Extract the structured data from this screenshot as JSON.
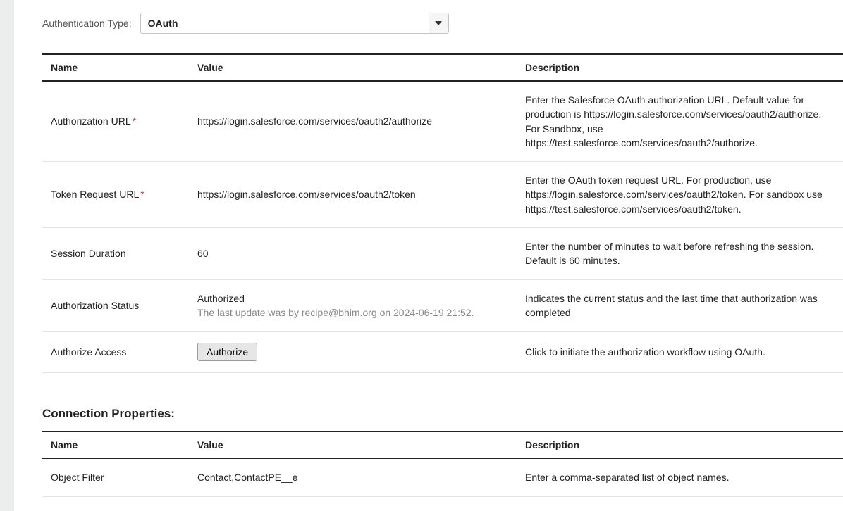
{
  "authType": {
    "label": "Authentication Type:",
    "value": "OAuth"
  },
  "propsHeader": {
    "name": "Name",
    "value": "Value",
    "description": "Description"
  },
  "rows": [
    {
      "name": "Authorization URL",
      "required": "*",
      "value": "https://login.salesforce.com/services/oauth2/authorize",
      "description": "Enter the Salesforce OAuth authorization URL. Default value for production is https://login.salesforce.com/services/oauth2/authorize. For Sandbox, use https://test.salesforce.com/services/oauth2/authorize."
    },
    {
      "name": "Token Request URL",
      "required": "*",
      "value": "https://login.salesforce.com/services/oauth2/token",
      "description": "Enter the OAuth token request URL. For production, use https://login.salesforce.com/services/oauth2/token. For sandbox use https://test.salesforce.com/services/oauth2/token."
    },
    {
      "name": "Session Duration",
      "required": "",
      "value": "60",
      "description": "Enter the number of minutes to wait before refreshing the session. Default is 60 minutes."
    },
    {
      "name": "Authorization Status",
      "required": "",
      "value": "Authorized",
      "sub": "The last update was by recipe@bhim.org on 2024-06-19 21:52.",
      "description": "Indicates the current status and the last time that authorization was completed"
    },
    {
      "name": "Authorize Access",
      "required": "",
      "button": "Authorize",
      "description": "Click to initiate the authorization workflow using OAuth."
    }
  ],
  "connProps": {
    "title": "Connection Properties:",
    "rows": [
      {
        "name": "Object Filter",
        "value": "Contact,ContactPE__e",
        "description": "Enter a comma-separated list of object names."
      }
    ]
  }
}
